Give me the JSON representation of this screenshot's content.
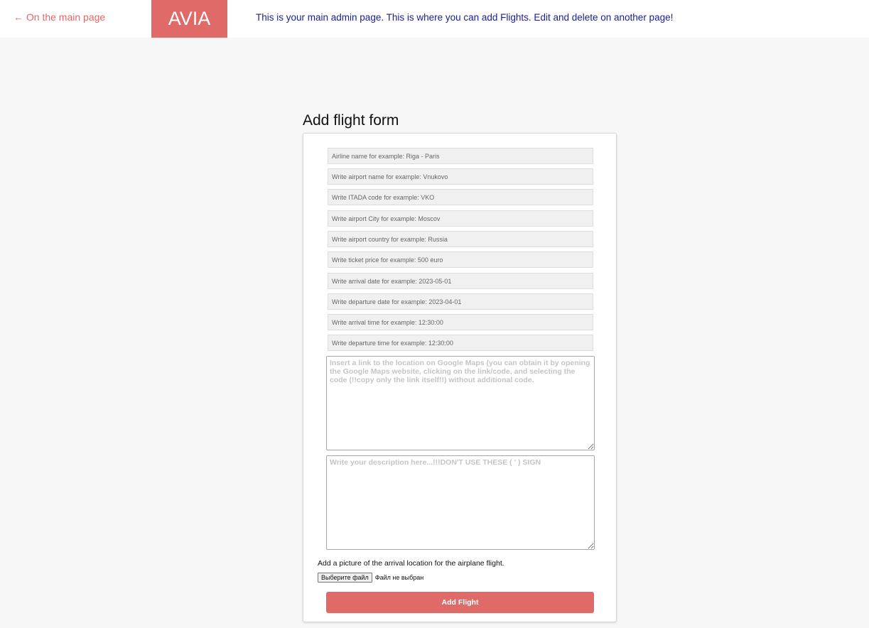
{
  "header": {
    "back_link": "← On the main page",
    "logo": "AVIA",
    "message": "This is your main admin page. This is where you can add Flights. Edit and delete on another page!"
  },
  "form": {
    "title": "Add flight form",
    "fields": {
      "airline": {
        "placeholder": "Airline name for example: Riga - Paris",
        "value": ""
      },
      "airport_name": {
        "placeholder": "Write airport name for example: Vnukovo",
        "value": ""
      },
      "itada_code": {
        "placeholder": "Write ITADA code for example: VKO",
        "value": ""
      },
      "airport_city": {
        "placeholder": "Write airport City for example: Moscov",
        "value": ""
      },
      "airport_country": {
        "placeholder": "Write airport country for example: Russia",
        "value": ""
      },
      "ticket_price": {
        "placeholder": "Write ticket price for example: 500 euro",
        "value": ""
      },
      "arrival_date": {
        "placeholder": "Write arrival date for example: 2023-05-01",
        "value": ""
      },
      "departure_date": {
        "placeholder": "Write departure date for example: 2023-04-01",
        "value": ""
      },
      "arrival_time": {
        "placeholder": "Write arrival time for example: 12:30:00",
        "value": ""
      },
      "departure_time": {
        "placeholder": "Write departure time for example: 12:30:00",
        "value": ""
      }
    },
    "maps_link": {
      "placeholder": "Insert a link to the location on Google Maps (you can obtain it by opening the Google Maps website, clicking on the link/code, and selecting the code (!!copy only the link itself!!) without additional code.",
      "value": ""
    },
    "description": {
      "placeholder": "Write your description here...!!!DON'T USE THESE ( ' ) SIGN",
      "value": ""
    },
    "picture": {
      "label": "Add a picture of the arrival location for the airplane flight.",
      "button": "Выберите файл",
      "status": "Файл не выбран"
    },
    "submit_label": "Add Flight"
  },
  "colors": {
    "accent": "#e06a68",
    "header_text": "#1c2090",
    "page_background": "#f7f7f7"
  }
}
